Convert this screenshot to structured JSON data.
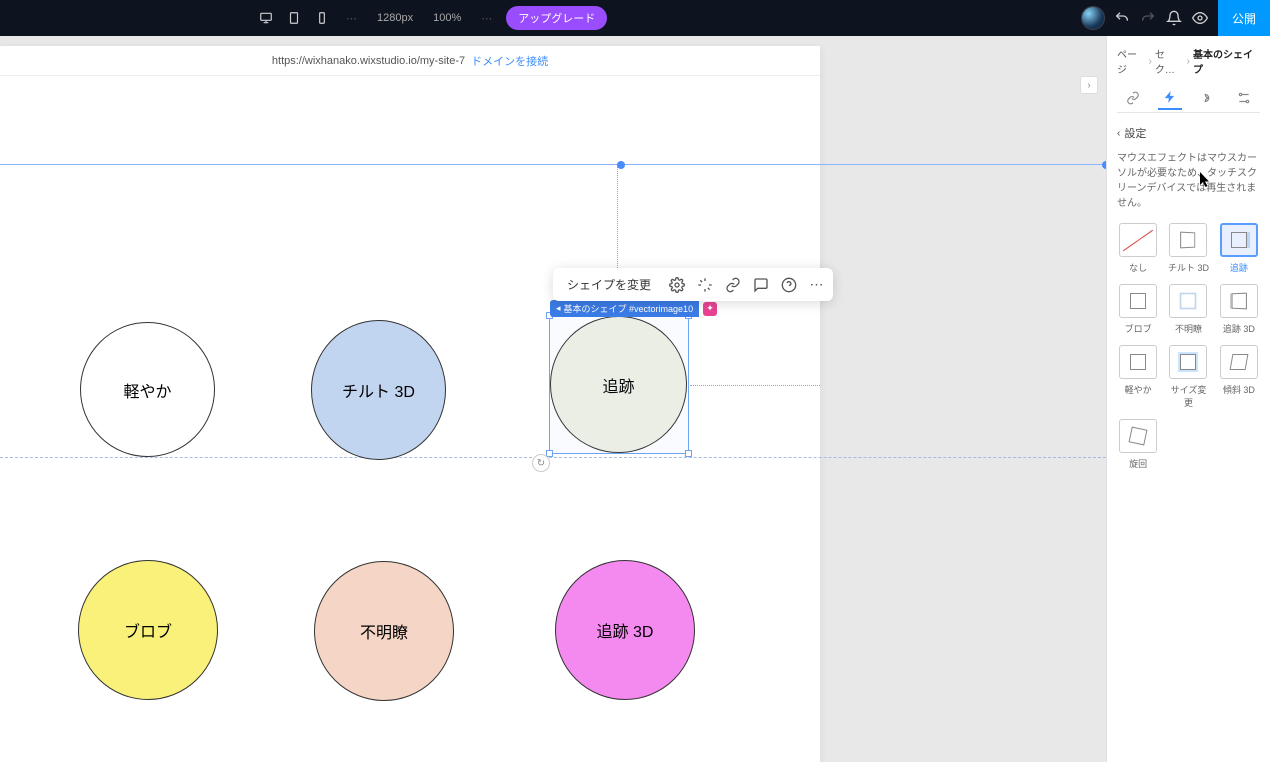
{
  "topbar": {
    "breakpoint": "1280px",
    "zoom": "100%",
    "ellipsis": "⋯",
    "upgrade_label": "アップグレード",
    "publish_label": "公開"
  },
  "url": {
    "text": "https://wixhanako.wixstudio.io/my-site-7",
    "link_text": "ドメインを接続"
  },
  "floating_toolbar": {
    "change_shape": "シェイプを変更"
  },
  "element_label": {
    "text": "基本のシェイプ #vectorimage10",
    "badge": "✦"
  },
  "canvas_shapes": {
    "s1": "軽やか",
    "s2": "チルト 3D",
    "s3": "追跡",
    "s4": "ブロブ",
    "s5": "不明瞭",
    "s6": "追跡 3D"
  },
  "breadcrumb": {
    "page": "ページ",
    "section": "セク…",
    "current": "基本のシェイプ"
  },
  "panel": {
    "back_label": "設定",
    "hint": "マウスエフェクトはマウスカーソルが必要なため、タッチスクリーンデバイスでは再生されません。"
  },
  "effects": [
    {
      "label": "なし",
      "variant": "none"
    },
    {
      "label": "チルト 3D",
      "variant": "tilt"
    },
    {
      "label": "追跡",
      "variant": "track",
      "selected": true
    },
    {
      "label": "ブロブ",
      "variant": "blob"
    },
    {
      "label": "不明瞭",
      "variant": "blur"
    },
    {
      "label": "追跡 3D",
      "variant": "track3d"
    },
    {
      "label": "軽やか",
      "variant": "glide"
    },
    {
      "label": "サイズ変更",
      "variant": "resize"
    },
    {
      "label": "傾斜 3D",
      "variant": "skew3d"
    },
    {
      "label": "旋回",
      "variant": "spin"
    }
  ]
}
